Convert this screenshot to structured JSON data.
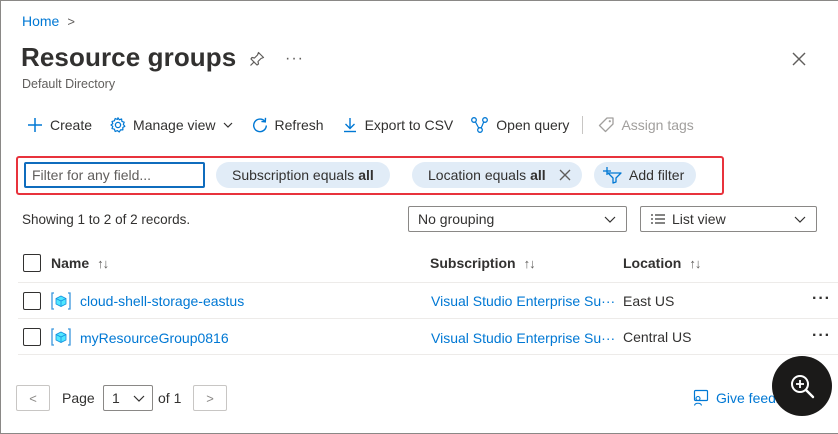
{
  "breadcrumb": {
    "home": "Home",
    "separator": ">"
  },
  "header": {
    "title": "Resource groups",
    "subtitle": "Default Directory",
    "more": "···",
    "pin_icon": "pin-icon",
    "close_icon": "close-icon"
  },
  "toolbar": {
    "create": "Create",
    "manage_view": "Manage view",
    "refresh": "Refresh",
    "export_csv": "Export to CSV",
    "open_query": "Open query",
    "assign_tags": "Assign tags"
  },
  "filters": {
    "placeholder": "Filter for any field...",
    "subscription_label": "Subscription equals",
    "subscription_value": "all",
    "location_label": "Location equals",
    "location_value": "all",
    "add_filter": "Add filter",
    "highlight_color": "#e8323c"
  },
  "records": {
    "showing": "Showing 1 to 2 of 2 records.",
    "grouping": "No grouping",
    "view": "List view"
  },
  "table": {
    "columns": {
      "name": "Name",
      "subscription": "Subscription",
      "location": "Location"
    },
    "sort_glyph": "↑↓",
    "rows": [
      {
        "name": "cloud-shell-storage-eastus",
        "subscription": "Visual Studio Enterprise Su···",
        "location": "East US"
      },
      {
        "name": "myResourceGroup0816",
        "subscription": "Visual Studio Enterprise Su···",
        "location": "Central US"
      }
    ],
    "row_menu": "···"
  },
  "pager": {
    "prev": "<",
    "page_label": "Page",
    "page_value": "1",
    "of_label": "of 1",
    "next": ">"
  },
  "feedback": {
    "label": "Give feedb"
  },
  "colors": {
    "accent": "#0078d4",
    "pill_bg": "#e1ecf7",
    "text": "#323130"
  }
}
